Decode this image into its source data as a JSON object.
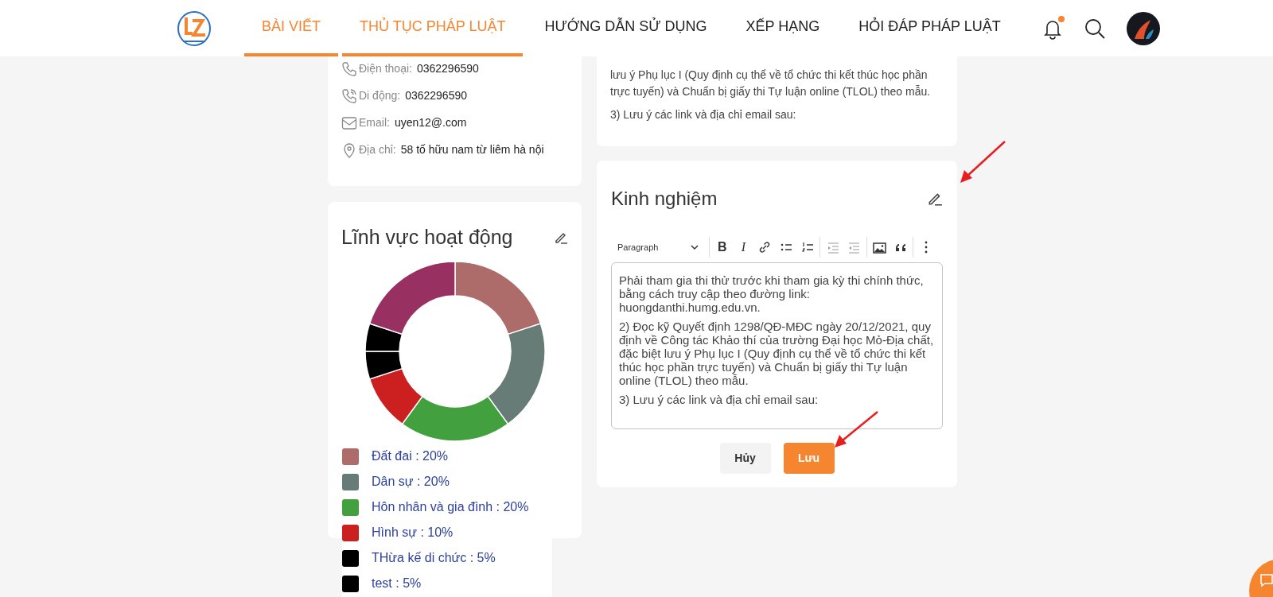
{
  "header": {
    "nav": [
      {
        "label": "BÀI VIẾT",
        "selected": true
      },
      {
        "label": "THỦ TỤC PHÁP LUẬT",
        "selected": true
      },
      {
        "label": "HƯỚNG DẪN SỬ DỤNG",
        "selected": false
      },
      {
        "label": "XẾP HẠNG",
        "selected": false
      },
      {
        "label": "HỎI ĐÁP PHÁP LUẬT",
        "selected": false
      }
    ],
    "notification_unread": true
  },
  "contact": {
    "rows": [
      {
        "kind": "phone",
        "label": "Điện thoại:",
        "value": "0362296590"
      },
      {
        "kind": "mobile",
        "label": "Di động:",
        "value": "0362296590"
      },
      {
        "kind": "email",
        "label": "Email:",
        "value": "uyen12@.com"
      },
      {
        "kind": "address",
        "label": "Địa chỉ:",
        "value": "58 tố hữu nam từ liêm hà nội"
      }
    ]
  },
  "fields_card": {
    "title": "Lĩnh vực hoạt động",
    "chart_data": {
      "type": "donut",
      "values": [
        20,
        20,
        20,
        10,
        5,
        5,
        20
      ],
      "colors": [
        "#ad6b6a",
        "#677c77",
        "#43a03e",
        "#cc2020",
        "#000000",
        "#000000",
        "#983062"
      ]
    },
    "legend": [
      {
        "label": "Đất đai : 20%",
        "color": "#ad6b6a"
      },
      {
        "label": "Dân sự : 20%",
        "color": "#677c77"
      },
      {
        "label": "Hôn nhân và gia đình : 20%",
        "color": "#43a03e"
      },
      {
        "label": "Hình sự : 10%",
        "color": "#cc2020"
      },
      {
        "label": "THừa kế di chức : 5%",
        "color": "#000000"
      },
      {
        "label": "test : 5%",
        "color": "#000000"
      }
    ]
  },
  "previous_card": {
    "paragraphs": [
      "lưu ý Phụ lục I (Quy định cụ thể về tổ chức thi kết thúc học phần trực tuyến) và Chuẩn bị giấy thi Tự luận online (TLOL) theo mẫu.",
      "3) Lưu ý các link và địa chỉ email sau:"
    ]
  },
  "experience_card": {
    "title": "Kinh nghiệm",
    "toolbar": {
      "format": "Paragraph",
      "groups": [
        [
          {
            "kind": "bold",
            "label": "B"
          },
          {
            "kind": "italic",
            "label": "I"
          },
          {
            "kind": "link"
          },
          {
            "kind": "bullets"
          },
          {
            "kind": "numbers"
          }
        ],
        [
          {
            "kind": "indent"
          },
          {
            "kind": "outdent"
          }
        ],
        [
          {
            "kind": "image"
          },
          {
            "kind": "quote"
          }
        ],
        [
          {
            "kind": "more"
          }
        ]
      ]
    },
    "paragraphs": [
      "Phải tham gia thi thử trước khi tham gia kỳ thi chính thức, bằng cách truy cập theo đường link: huongdanthi.humg.edu.vn.",
      "2) Đọc kỹ Quyết định 1298/QĐ-MĐC ngày 20/12/2021, quy định về Công tác Khảo thí của trường Đại học Mỏ-Địa chất, đặc biệt lưu ý Phụ lục I (Quy định cụ thể về tổ chức thi kết thúc học phần trực tuyến) và Chuẩn bị giấy thi Tự luận online (TLOL) theo mẫu.",
      "3) Lưu ý các link và địa chỉ email sau:"
    ],
    "cancel": "Hủy",
    "save": "Lưu"
  }
}
